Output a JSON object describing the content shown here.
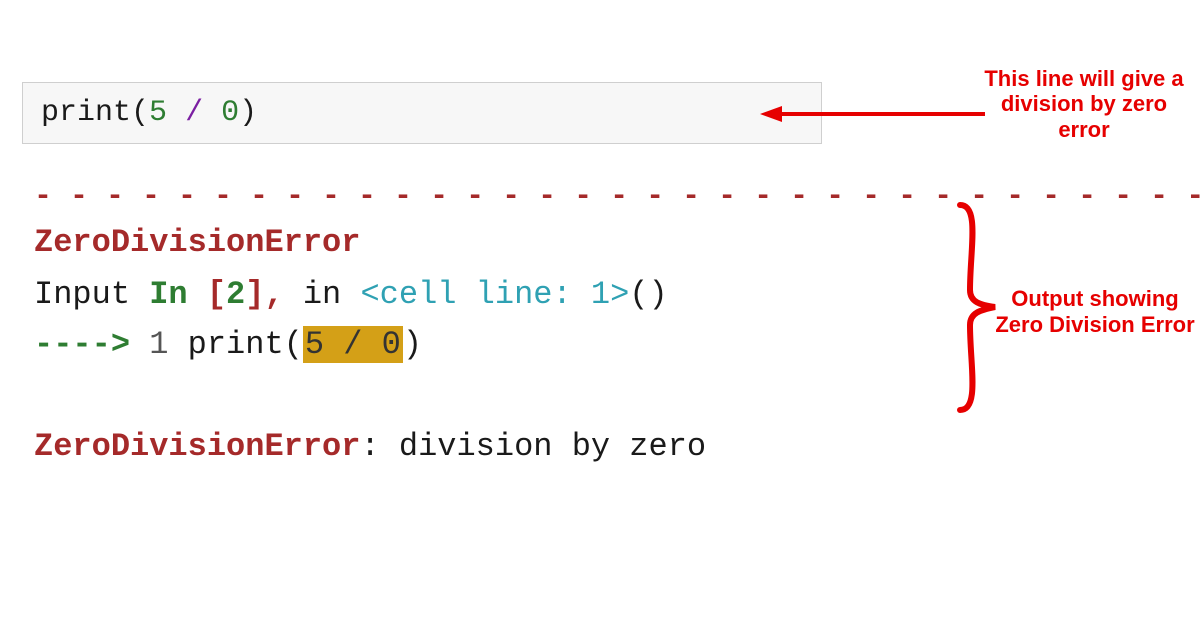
{
  "code": {
    "func": "print",
    "lparen": "(",
    "num1": "5",
    "sp1": " ",
    "op": "/",
    "sp2": " ",
    "num2": "0",
    "rparen": ")"
  },
  "dashes": "- - - - - - - - - - - - - - - - - - - - - - - - - - - - - - - - - - - - -",
  "error_name": "ZeroDivisionError",
  "traceback": {
    "input": "Input ",
    "in": "In ",
    "lb": "[",
    "num": "2",
    "rb": "]",
    "comma": ",",
    "in_word": " in ",
    "cell": "<cell line: 1>",
    "paren": "()"
  },
  "arrowline": {
    "arrow": "----> ",
    "lineno": "1 ",
    "func": "print",
    "lparen": "(",
    "hl": "5 / 0",
    "rparen": ")"
  },
  "final": {
    "name": "ZeroDivisionError",
    "colon": ": ",
    "msg": "division by zero"
  },
  "annotation1": "This line will give a division by zero error",
  "annotation2": "Output showing Zero Division Error",
  "colors": {
    "red": "#e60000"
  }
}
